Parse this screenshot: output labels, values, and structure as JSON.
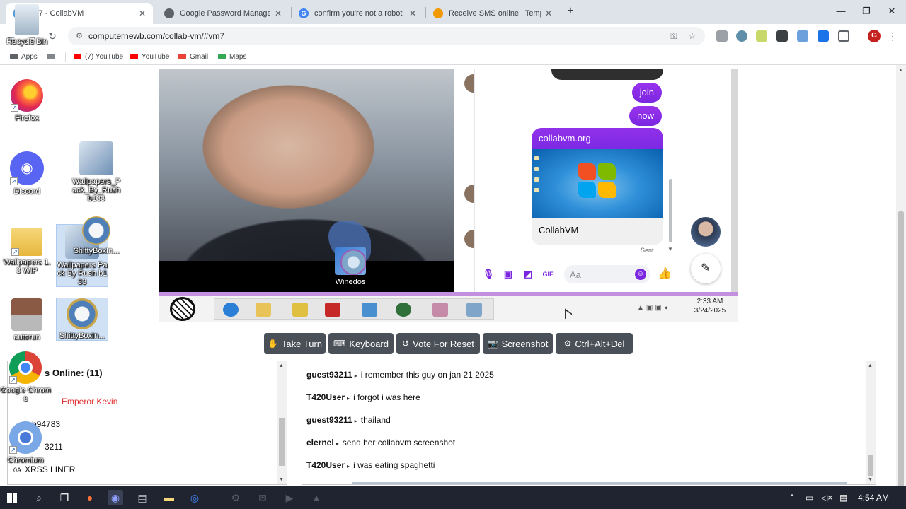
{
  "browser": {
    "tabs": [
      {
        "title": "vm7 - CollabVM",
        "active": true,
        "favicon_color": "#5b9bd5"
      },
      {
        "title": "Google Password Manager",
        "active": false,
        "favicon_color": "#5f6368"
      },
      {
        "title": "confirm you're not a robot goo",
        "active": false,
        "favicon_color": "#4285f4"
      },
      {
        "title": "Receive SMS online | Temporar",
        "active": false,
        "favicon_color": "#f29900"
      }
    ],
    "url": "computernewb.com/collab-vm/#vm7",
    "profile_initial": "G",
    "bookmarks": [
      {
        "label": "Apps",
        "color": "#5f6368"
      },
      {
        "label": "(7) YouTube",
        "color": "#ff0000"
      },
      {
        "label": "YouTube",
        "color": "#ff0000"
      },
      {
        "label": "Gmail",
        "color": "#ea4335"
      },
      {
        "label": "Maps",
        "color": "#34a853"
      }
    ]
  },
  "vm": {
    "messenger": {
      "messages": [
        "join",
        "now"
      ],
      "link_card": {
        "site": "collabvm.org",
        "title": "CollabVM"
      },
      "sent_label": "Sent",
      "composer_placeholder": "Aa"
    },
    "desktop_icon": "Winedos",
    "clock": {
      "time": "2:33 AM",
      "date": "3/24/2025"
    }
  },
  "controls": [
    {
      "label": "Take Turn",
      "icon": "hand-icon"
    },
    {
      "label": "Keyboard",
      "icon": "keyboard-icon"
    },
    {
      "label": "Vote For Reset",
      "icon": "reset-icon"
    },
    {
      "label": "Screenshot",
      "icon": "camera-icon"
    },
    {
      "label": "Ctrl+Alt+Del",
      "icon": "gear-icon"
    }
  ],
  "users_panel": {
    "header": "s Online: (11)",
    "users": [
      "Emperor Kevin",
      "b94783",
      "3211",
      "XRSS LINER"
    ],
    "user_prefix_last": "0A"
  },
  "chat": [
    {
      "user": "guest93211",
      "message": "i remember this guy on jan 21 2025"
    },
    {
      "user": "T420User",
      "message": "i forgot i was here"
    },
    {
      "user": "guest93211",
      "message": "thailand"
    },
    {
      "user": "elernel",
      "message": "send her collabvm screenshot"
    },
    {
      "user": "T420User",
      "message": "i was eating spaghetti"
    }
  ],
  "desktop_icons": [
    {
      "label": "Recycle Bin"
    },
    {
      "label": "Firefox"
    },
    {
      "label": "Discord"
    },
    {
      "label": "Wallpapers_Pack_By_Rush b133"
    },
    {
      "label": "Wallpapers 1.3 WIP"
    },
    {
      "label": "Wallpapers Pack By Rush b133"
    },
    {
      "label": "ShittyBoxIn..."
    },
    {
      "label": "autorun"
    },
    {
      "label": "ShittyBoxIn..."
    },
    {
      "label": "Google Chrome"
    },
    {
      "label": "Chromium"
    }
  ],
  "taskbar": {
    "time": "4:54 AM"
  }
}
